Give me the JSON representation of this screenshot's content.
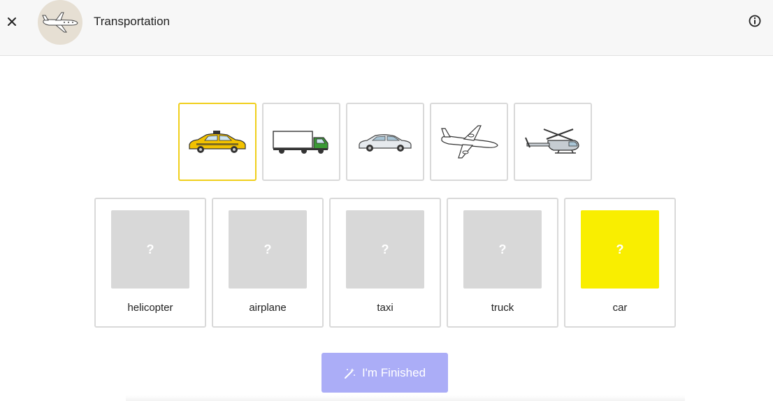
{
  "header": {
    "title": "Transportation",
    "close_icon": "close-icon",
    "avatar_icon": "airplane-icon",
    "info_icon": "info-icon"
  },
  "tiles": [
    {
      "icon": "taxi",
      "selected": true
    },
    {
      "icon": "truck",
      "selected": false
    },
    {
      "icon": "car",
      "selected": false
    },
    {
      "icon": "airplane",
      "selected": false
    },
    {
      "icon": "helicopter",
      "selected": false
    }
  ],
  "cards": [
    {
      "label": "helicopter",
      "placeholder": "?",
      "active": false
    },
    {
      "label": "airplane",
      "placeholder": "?",
      "active": false
    },
    {
      "label": "taxi",
      "placeholder": "?",
      "active": false
    },
    {
      "label": "truck",
      "placeholder": "?",
      "active": false
    },
    {
      "label": "car",
      "placeholder": "?",
      "active": true
    }
  ],
  "finish_button": {
    "label": "I'm Finished",
    "icon": "magic-wand-icon"
  },
  "colors": {
    "accent_yellow": "#f9ee00",
    "selected_border": "#f0cf1c",
    "button": "#abadf7",
    "slot": "#d8d8d8"
  }
}
